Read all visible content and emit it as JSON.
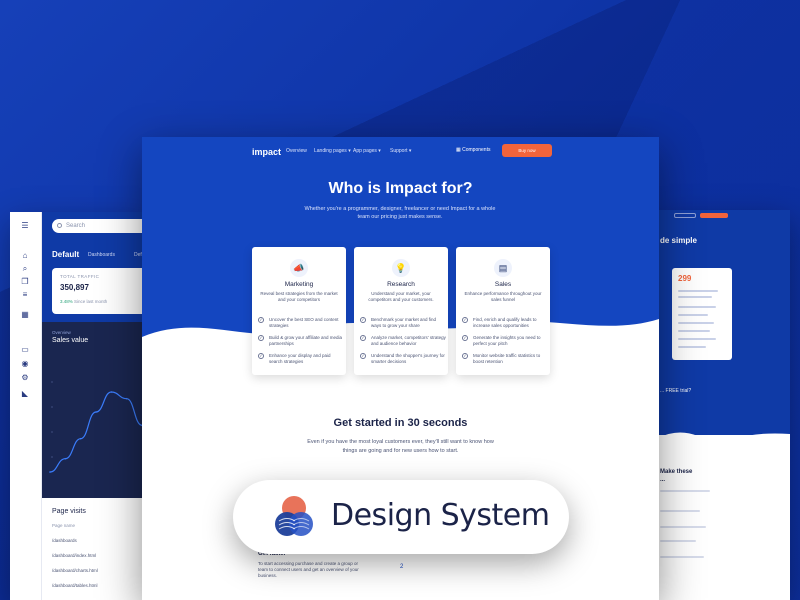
{
  "colors": {
    "brand_blue": "#1446c0",
    "accent_orange": "#f2643b",
    "dark_navy": "#1a2650",
    "text_dark": "#1b2348"
  },
  "dashboard": {
    "search_placeholder": "Search",
    "breadcrumb_title": "Default",
    "breadcrumb_item1": "Dashboards",
    "breadcrumb_item2": "Default",
    "stat_label": "TOTAL TRAFFIC",
    "stat_value": "350,897",
    "stat_change": "3.48%",
    "stat_change_note": "Since last month",
    "chart_overline": "Overview",
    "chart_title": "Sales value",
    "chart_data": {
      "type": "line",
      "values": [
        0,
        4,
        10,
        18,
        24,
        22,
        14
      ]
    },
    "visits_title": "Page visits",
    "visits_header": "Page name",
    "visits_rows": [
      "/dashboards",
      "/dashboard/index.html",
      "/dashboard/charts.html",
      "/dashboard/tables.html"
    ],
    "rail_icons": [
      "menu-icon",
      "home-icon",
      "search-icon",
      "copy-icon",
      "list-icon",
      "table-icon",
      "file-icon",
      "user-icon",
      "settings-icon",
      "book-icon"
    ]
  },
  "pricing": {
    "title": "de simple",
    "price": "299",
    "free_text": "... FREE trial?",
    "lower_title_1": "Make these",
    "lower_title_2": "..."
  },
  "landing": {
    "nav": {
      "logo": "impact",
      "links": [
        "Overview",
        "Landing pages ▾",
        "App pages ▾",
        "Support ▾"
      ],
      "components": "Components",
      "cta": "Buy now"
    },
    "headline": "Who is Impact for?",
    "subline": "Whether you're a programmer, designer, freelancer or need Impact for a whole team our pricing just makes sense.",
    "cards": [
      {
        "icon": "megaphone-icon",
        "glyph": "📣",
        "title": "Marketing",
        "desc": "Reveal best strategies from the market and your competitors",
        "items": [
          "Uncover the best SEO and content strategies",
          "Build & grow your affiliate and media partnerships",
          "Enhance your display and paid search strategies"
        ]
      },
      {
        "icon": "lightbulb-icon",
        "glyph": "💡",
        "title": "Research",
        "desc": "Understand your market, your competitors and your customers.",
        "items": [
          "Benchmark your market and find ways to grow your share",
          "Analyze market, competitors' strategy and audience behavior",
          "Understand the shopper's journey for smarter decisions"
        ]
      },
      {
        "icon": "chart-doc-icon",
        "glyph": "▤",
        "title": "Sales",
        "desc": "Enhance performance throughout your sales funnel",
        "items": [
          "Find, enrich and qualify leads to increase sales opportunities",
          "Generate the insights you need to perfect your pitch",
          "Monitor website traffic statistics to boost retention"
        ]
      }
    ],
    "getting_started_title": "Get started in 30 seconds",
    "getting_started_sub": "Even if you have the most loyal customers ever, they'll still want to know how things are going and for new users how to start.",
    "lower_title": "Get faster",
    "lower_text": "To start accessing purchase and create a group or team to connect users and get an overview of your business.",
    "lower_number": "2"
  },
  "badge": {
    "label": "Design System"
  }
}
